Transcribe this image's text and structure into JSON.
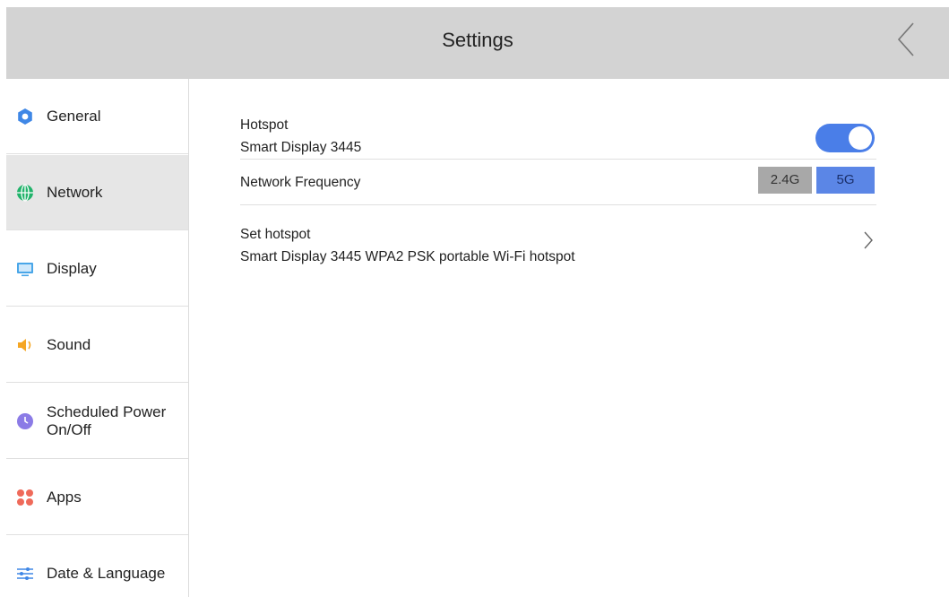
{
  "header": {
    "title": "Settings",
    "back_icon": "chevron-left-icon"
  },
  "sidebar": {
    "items": [
      {
        "label": "General",
        "icon": "gear-icon",
        "color": "#3f87e6",
        "active": false
      },
      {
        "label": "Network",
        "icon": "globe-icon",
        "color": "#22b36b",
        "active": true
      },
      {
        "label": "Display",
        "icon": "monitor-icon",
        "color": "#49a6e8",
        "active": false
      },
      {
        "label": "Sound",
        "icon": "speaker-icon",
        "color": "#f5a623",
        "active": false
      },
      {
        "label": "Scheduled Power On/Off",
        "icon": "clock-icon",
        "color": "#8b7be6",
        "active": false
      },
      {
        "label": "Apps",
        "icon": "apps-icon",
        "color": "#ef6a5a",
        "active": false
      },
      {
        "label": "Date & Language",
        "icon": "sliders-icon",
        "color": "#3f87e6",
        "active": false
      }
    ]
  },
  "hotspot": {
    "title": "Hotspot",
    "name": "Smart Display 3445",
    "enabled": true
  },
  "frequency": {
    "label": "Network Frequency",
    "options": [
      "2.4G",
      "5G"
    ],
    "selected": "5G"
  },
  "set_hotspot": {
    "title": "Set hotspot",
    "description": "Smart Display 3445 WPA2 PSK portable Wi-Fi hotspot"
  },
  "colors": {
    "accent": "#4a7ee8",
    "header_bg": "#d3d3d3",
    "active_item_bg": "#e6e6e6"
  }
}
